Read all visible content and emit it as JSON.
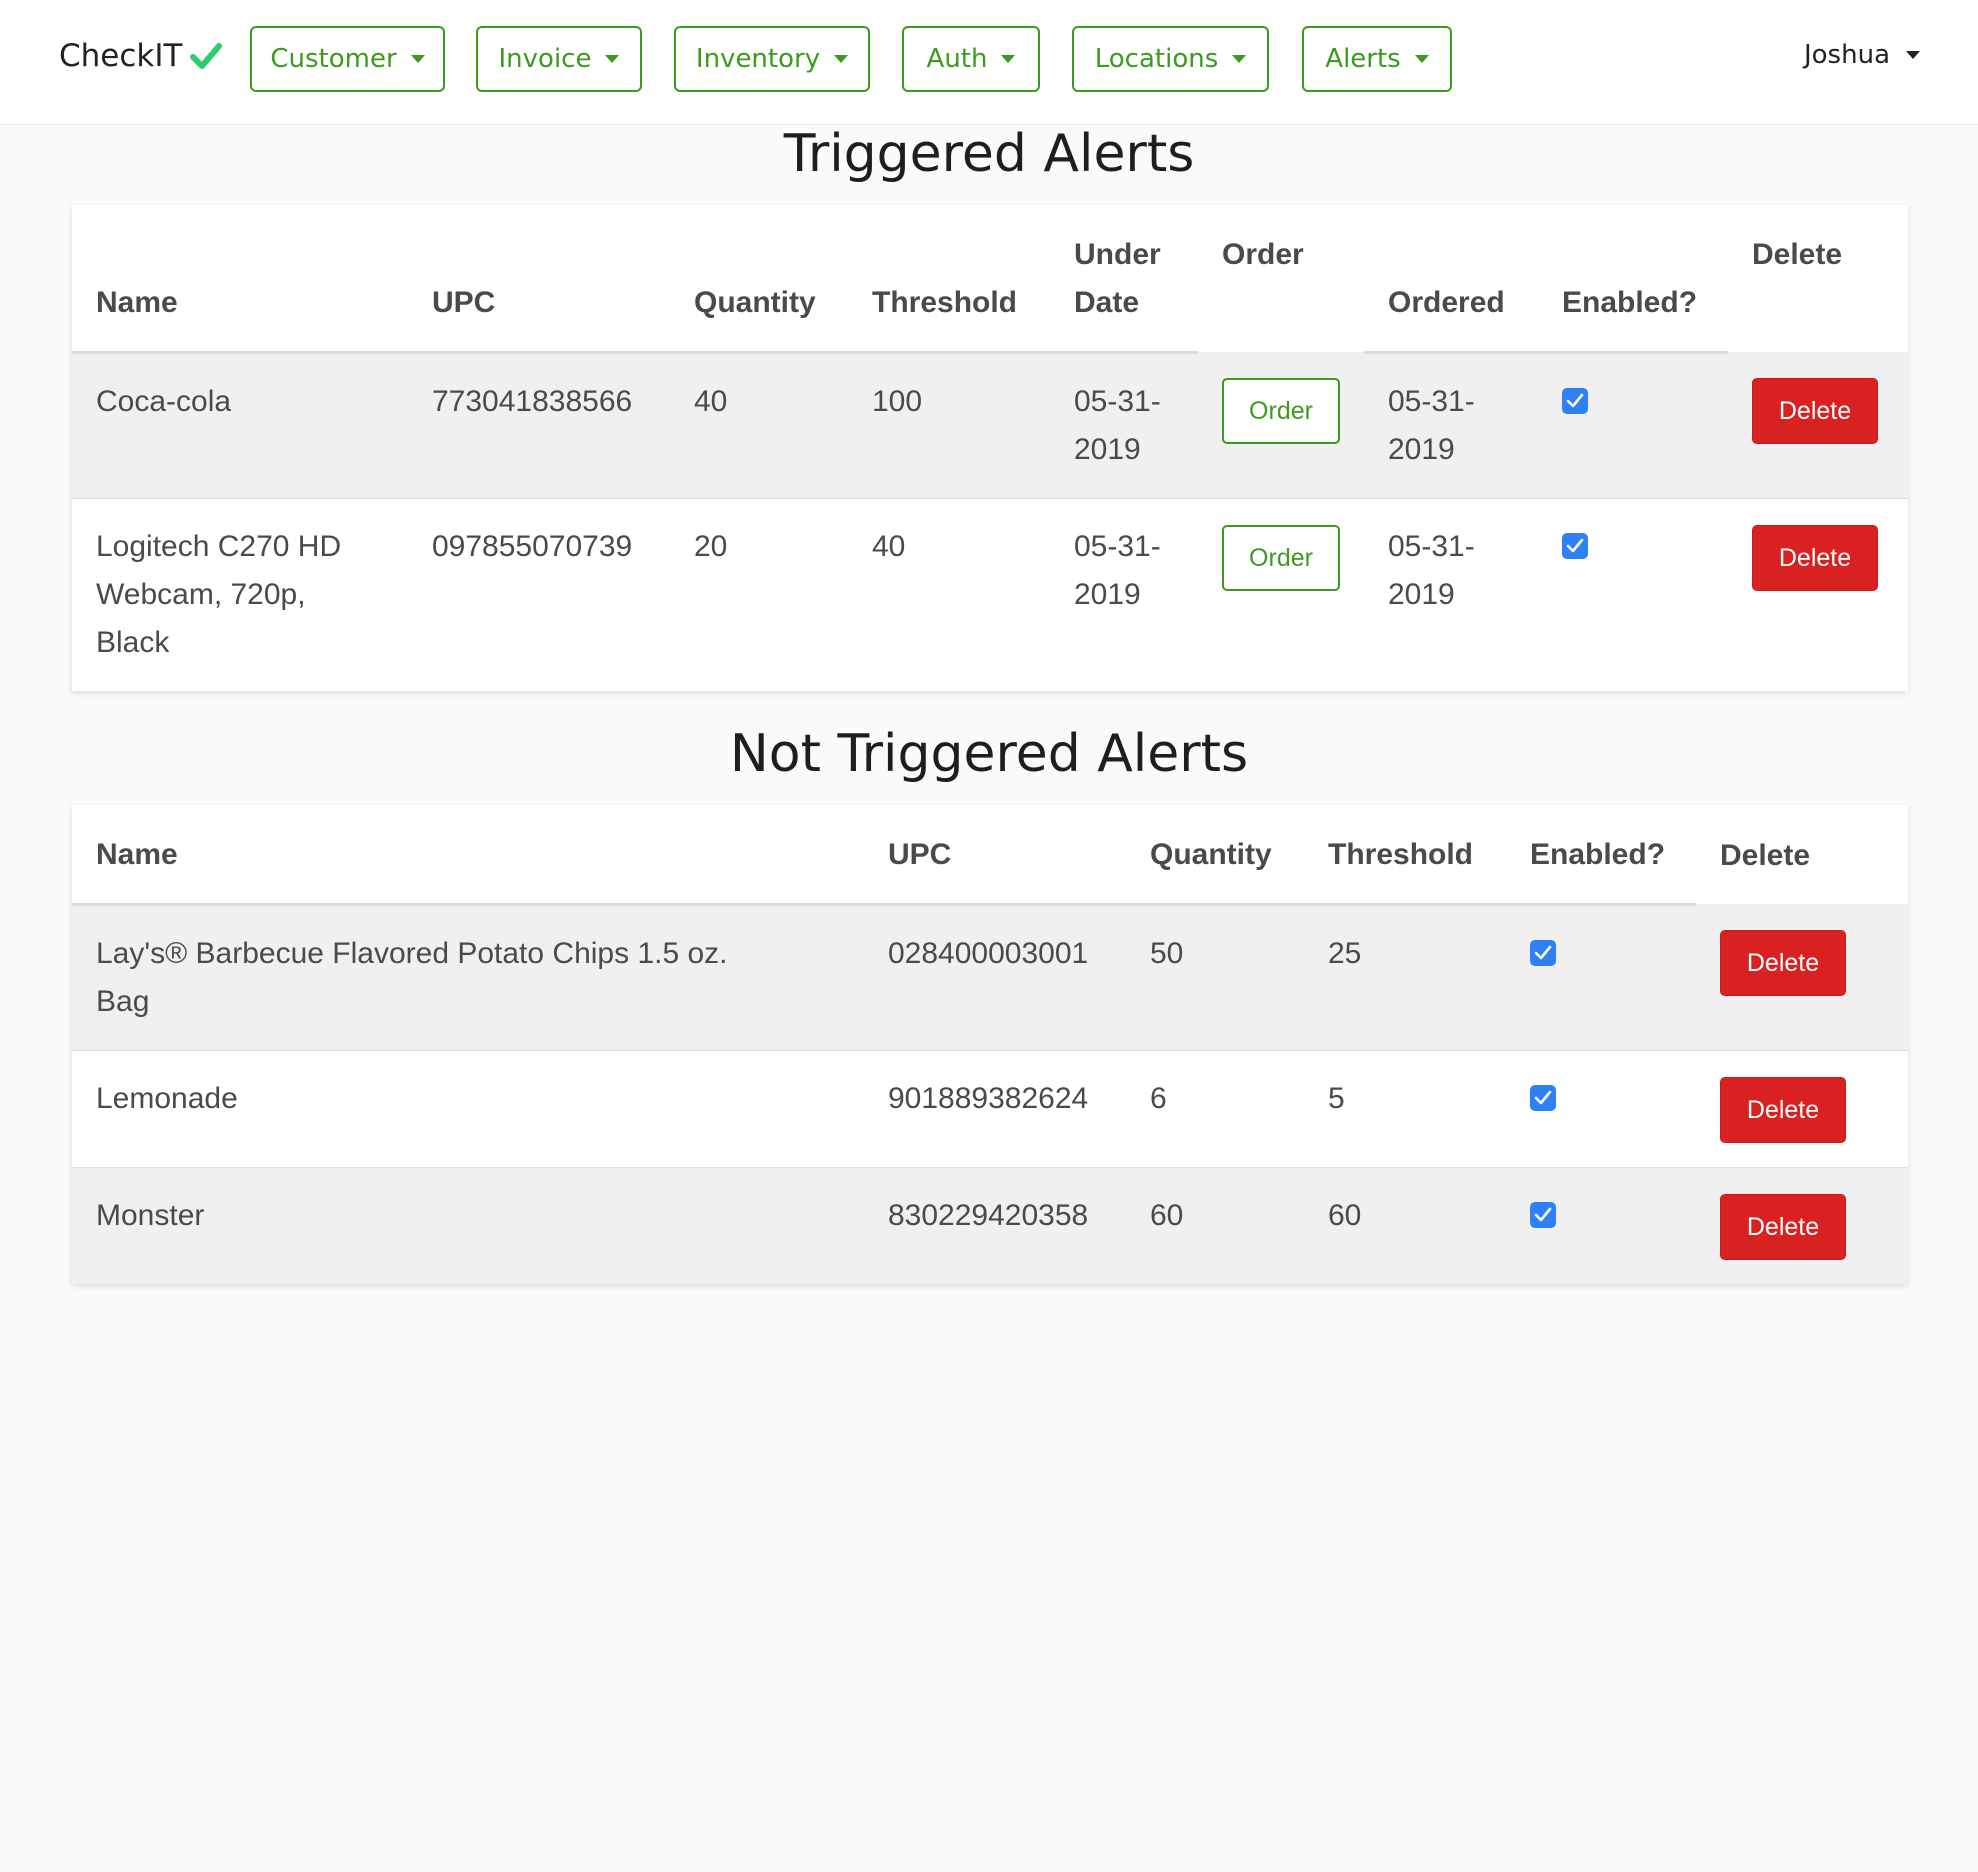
{
  "navbar": {
    "brand": "CheckIT",
    "menus": [
      {
        "label": "Customer"
      },
      {
        "label": "Invoice"
      },
      {
        "label": "Inventory"
      },
      {
        "label": "Auth"
      },
      {
        "label": "Locations"
      },
      {
        "label": "Alerts"
      }
    ],
    "user": "Joshua"
  },
  "triggered": {
    "title": "Triggered Alerts",
    "headers": {
      "name": "Name",
      "upc": "UPC",
      "quantity": "Quantity",
      "threshold": "Threshold",
      "under_date_1": "Under",
      "under_date_2": "Date",
      "order": "Order",
      "ordered": "Ordered",
      "enabled": "Enabled?",
      "delete": "Delete"
    },
    "order_button": "Order",
    "delete_button": "Delete",
    "rows": [
      {
        "name_lines": [
          "Coca-cola"
        ],
        "upc": "773041838566",
        "quantity": "40",
        "threshold": "100",
        "under_date_lines": [
          "05-31-",
          "2019"
        ],
        "ordered_lines": [
          "05-31-",
          "2019"
        ],
        "enabled": true
      },
      {
        "name_lines": [
          "Logitech C270 HD",
          "Webcam, 720p,",
          "Black"
        ],
        "upc": "097855070739",
        "quantity": "20",
        "threshold": "40",
        "under_date_lines": [
          "05-31-",
          "2019"
        ],
        "ordered_lines": [
          "05-31-",
          "2019"
        ],
        "enabled": true
      }
    ]
  },
  "not_triggered": {
    "title": "Not Triggered Alerts",
    "headers": {
      "name": "Name",
      "upc": "UPC",
      "quantity": "Quantity",
      "threshold": "Threshold",
      "enabled": "Enabled?",
      "delete": "Delete"
    },
    "delete_button": "Delete",
    "rows": [
      {
        "name_lines": [
          "Lay's® Barbecue Flavored Potato Chips 1.5 oz.",
          "Bag"
        ],
        "upc": "028400003001",
        "quantity": "50",
        "threshold": "25",
        "enabled": true
      },
      {
        "name_lines": [
          "Lemonade"
        ],
        "upc": "901889382624",
        "quantity": "6",
        "threshold": "5",
        "enabled": true
      },
      {
        "name_lines": [
          "Monster"
        ],
        "upc": "830229420358",
        "quantity": "60",
        "threshold": "60",
        "enabled": true
      }
    ]
  },
  "colors": {
    "accent_green": "#3c9a1e",
    "brand_check": "#2ecc71",
    "delete_red": "#d92121",
    "checkbox_blue": "#2f7ff5"
  }
}
